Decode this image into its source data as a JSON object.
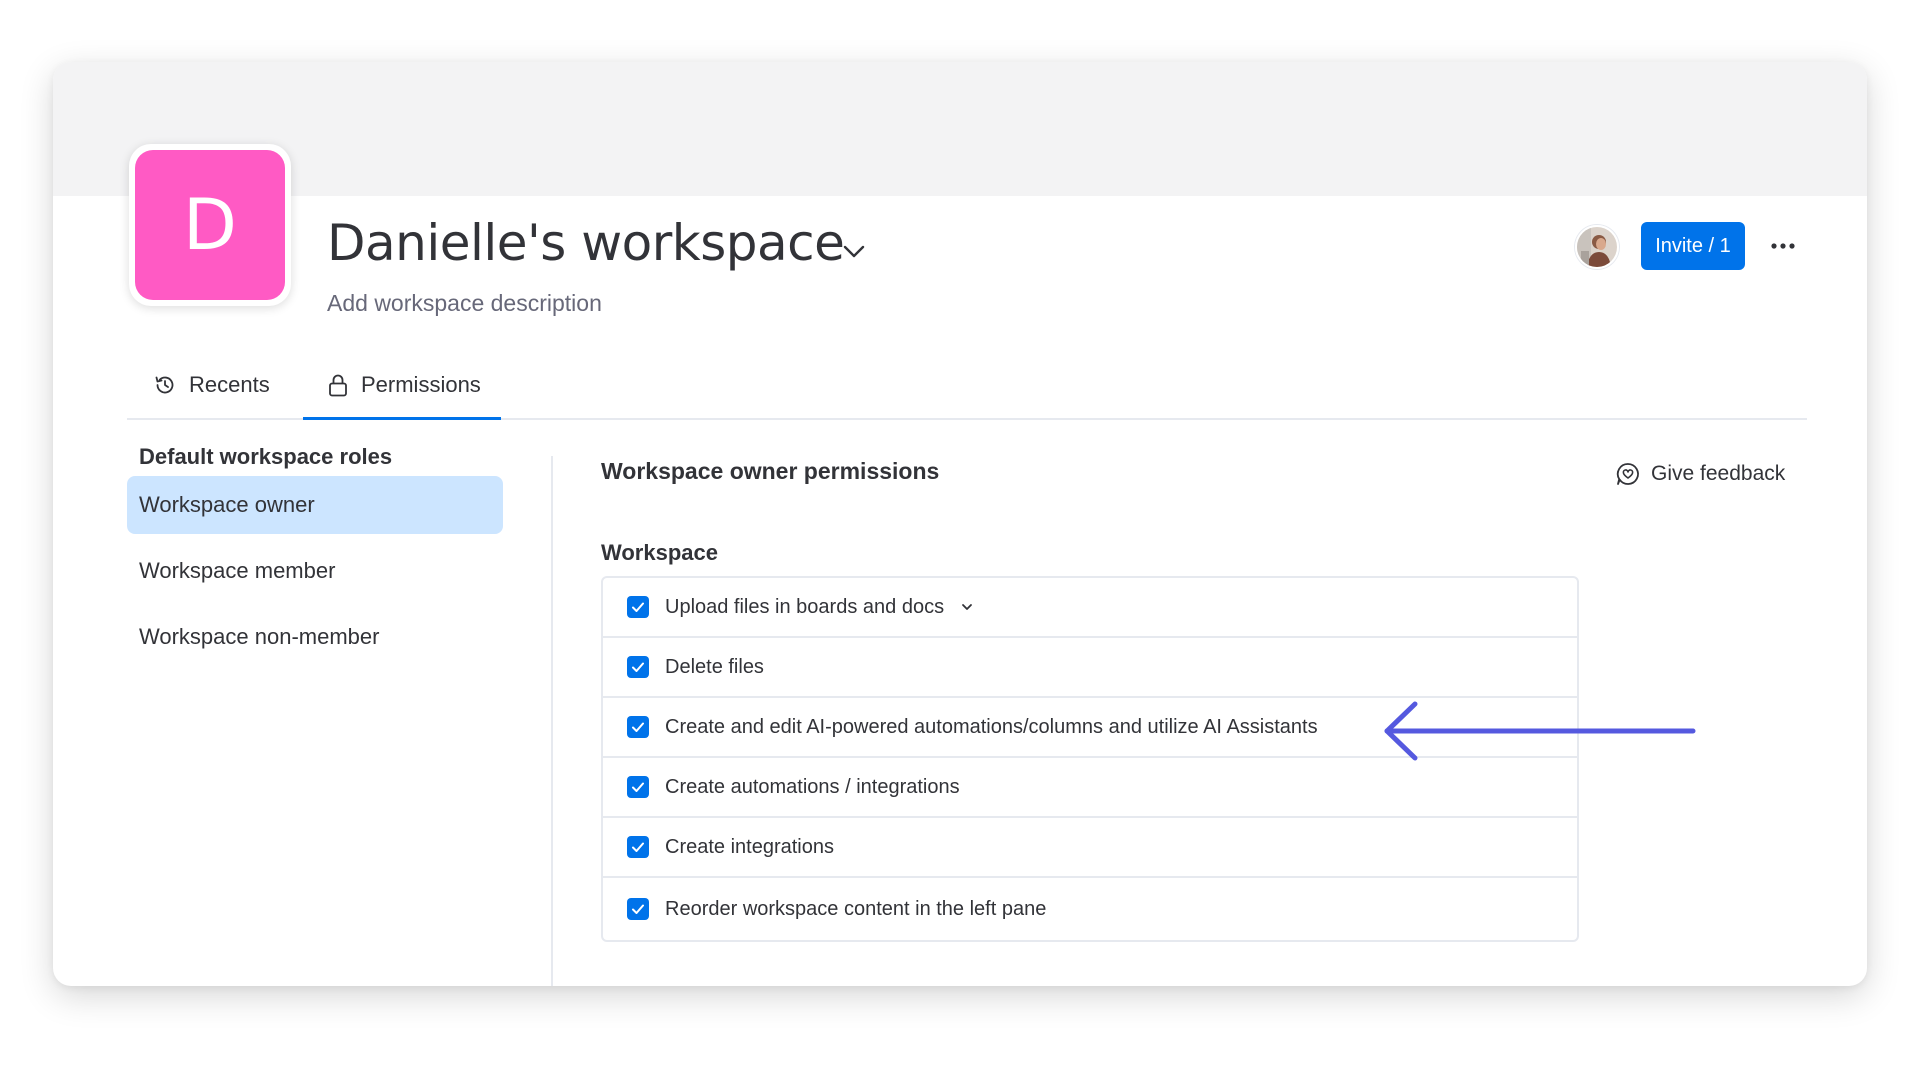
{
  "workspace": {
    "initial": "D",
    "avatar_color": "#ff5ac4",
    "title": "Danielle's workspace",
    "description_placeholder": "Add workspace description"
  },
  "header": {
    "invite_label": "Invite / 1",
    "invite_color": "#0073ea",
    "more_icon": "more-dots-icon",
    "user_avatar_icon": "user-avatar"
  },
  "tabs": [
    {
      "label": "Recents",
      "icon": "history-icon",
      "active": false
    },
    {
      "label": "Permissions",
      "icon": "lock-icon",
      "active": true
    }
  ],
  "roles": {
    "heading": "Default workspace roles",
    "items": [
      {
        "label": "Workspace owner",
        "selected": true
      },
      {
        "label": "Workspace member",
        "selected": false
      },
      {
        "label": "Workspace non-member",
        "selected": false
      }
    ]
  },
  "permissions": {
    "title": "Workspace owner permissions",
    "feedback_label": "Give feedback",
    "group_title": "Workspace",
    "items": [
      {
        "label": "Upload files in boards and docs",
        "checked": true,
        "expandable": true
      },
      {
        "label": "Delete files",
        "checked": true,
        "expandable": false
      },
      {
        "label": "Create and edit AI-powered automations/columns and utilize AI Assistants",
        "checked": true,
        "expandable": false
      },
      {
        "label": "Create automations / integrations",
        "checked": true,
        "expandable": false
      },
      {
        "label": "Create integrations",
        "checked": true,
        "expandable": false
      },
      {
        "label": "Reorder workspace content in the left pane",
        "checked": true,
        "expandable": false
      }
    ]
  },
  "colors": {
    "accent": "#0073ea",
    "selected_role_bg": "#cce5ff",
    "annotation_arrow": "#5559df"
  }
}
